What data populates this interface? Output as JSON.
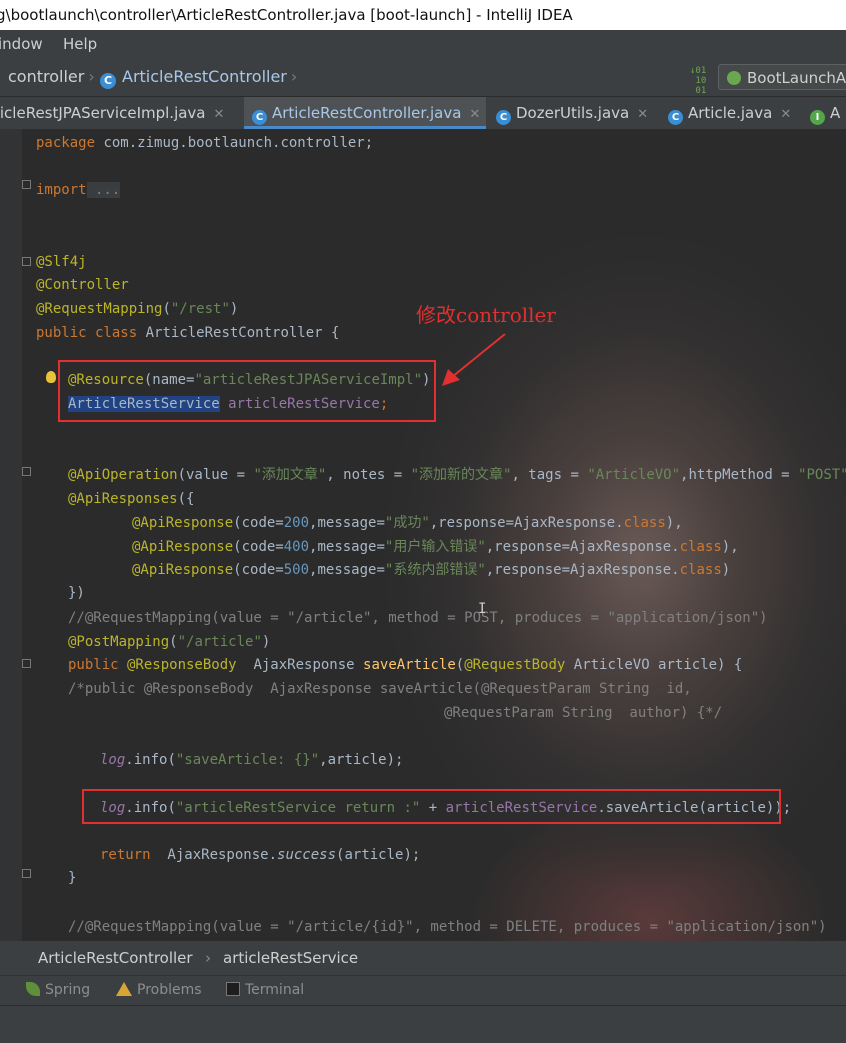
{
  "window": {
    "title": "g\\bootlaunch\\controller\\ArticleRestController.java [boot-launch] - IntelliJ IDEA"
  },
  "menu": {
    "items": [
      "Window",
      "Help"
    ],
    "display": [
      "indow",
      "Help"
    ]
  },
  "nav": {
    "crumbs": [
      "controller",
      "ArticleRestController"
    ],
    "run_config": "BootLaunchA",
    "binary_icon_text": "01\n10\n01"
  },
  "tabs": [
    {
      "label": "ticleRestJPAServiceImpl.java",
      "icon": "class-icon",
      "active": false
    },
    {
      "label": "ArticleRestController.java",
      "icon": "class-icon",
      "active": true
    },
    {
      "label": "DozerUtils.java",
      "icon": "class-icon",
      "active": false
    },
    {
      "label": "Article.java",
      "icon": "class-icon",
      "active": false
    },
    {
      "label": "A",
      "icon": "interface-icon",
      "active": false
    }
  ],
  "tab_close": "✕",
  "code": {
    "package_kw": "package",
    "package_name": " com.zimug.bootlaunch.controller;",
    "import_kw": "import",
    "import_fold": " ...",
    "ann_slf4j": "@Slf4j",
    "ann_controller": "@Controller",
    "ann_reqmap": "@RequestMapping",
    "reqmap_arg": "\"/rest\"",
    "class_decl_kw": "public class",
    "class_name": " ArticleRestController {",
    "resource_ann": "@Resource",
    "resource_pre": "(name=",
    "resource_val": "\"articleRestJPAServiceImpl\"",
    "resource_post": ")",
    "field_type": "ArticleRestService",
    "field_name": " articleRestService",
    "field_semi": ";",
    "apiop_ann": "@ApiOperation",
    "apiop_p1": "(value = ",
    "apiop_v1": "\"添加文章\"",
    "apiop_p2": ", notes = ",
    "apiop_v2": "\"添加新的文章\"",
    "apiop_p3": ", tags = ",
    "apiop_v3": "\"ArticleVO\"",
    "apiop_p4": ",httpMethod = ",
    "apiop_v4": "\"POST\"",
    "apiop_p5": ")",
    "apiresps_ann": "@ApiResponses",
    "apiresps_open": "({",
    "apiresp_ann": "@ApiResponse",
    "responses": [
      {
        "code": "200",
        "message": "\"成功\"",
        "end": "),"
      },
      {
        "code": "400",
        "message": "\"用户输入错误\"",
        "end": "),"
      },
      {
        "code": "500",
        "message": "\"系统内部错误\"",
        "end": ")"
      }
    ],
    "resp_code_pre": "(code=",
    "resp_msg_pre": ",message=",
    "resp_resp_pre": ",response=AjaxResponse.",
    "resp_class_kw": "class",
    "apiresps_close": "})",
    "comment_reqmap": "//@RequestMapping(value = \"/article\", method = POST, produces = \"application/json\")",
    "postmap_ann": "@PostMapping",
    "postmap_arg": "\"/article\"",
    "method_public": "public",
    "method_respbody": " @ResponseBody",
    "method_ret": "  AjaxResponse ",
    "method_name": "saveArticle",
    "method_reqbody": "@RequestBody",
    "method_params": " ArticleVO article) {",
    "comment_block1": "/*public @ResponseBody  AjaxResponse saveArticle(@RequestParam String  id,",
    "comment_block2": "@RequestParam String  author) {*/",
    "log1_obj": "log",
    "log1_info": ".info(",
    "log1_str": "\"saveArticle: {}\"",
    "log1_end": ",article);",
    "log2_obj": "log",
    "log2_info": ".info(",
    "log2_str": "\"articleRestService return :\"",
    "log2_plus": " + ",
    "log2_field": "articleRestService",
    "log2_call": ".saveArticle(article));",
    "return_kw": "return",
    "return_rest_pre": "  AjaxResponse.",
    "return_success": "success",
    "return_rest_post": "(article);",
    "close_brace": "}",
    "comment_delete": "//@RequestMapping(value = \"/article/{id}\", method = DELETE, produces = \"application/json\")"
  },
  "annotation_text": "修改controller",
  "cursor_glyph": "I",
  "breadcrumb_bottom": [
    "ArticleRestController",
    "articleRestService"
  ],
  "breadcrumb_sep": "›",
  "tool_windows": [
    {
      "label": "Spring",
      "icon": "spring-leaf-icon"
    },
    {
      "label": "Problems",
      "icon": "warning-icon"
    },
    {
      "label": "Terminal",
      "icon": "terminal-icon"
    }
  ],
  "colors": {
    "keyword": "#cc7832",
    "annotation": "#bbb529",
    "string": "#6a8759",
    "number": "#6897bb",
    "highlight_box": "#e03030"
  }
}
